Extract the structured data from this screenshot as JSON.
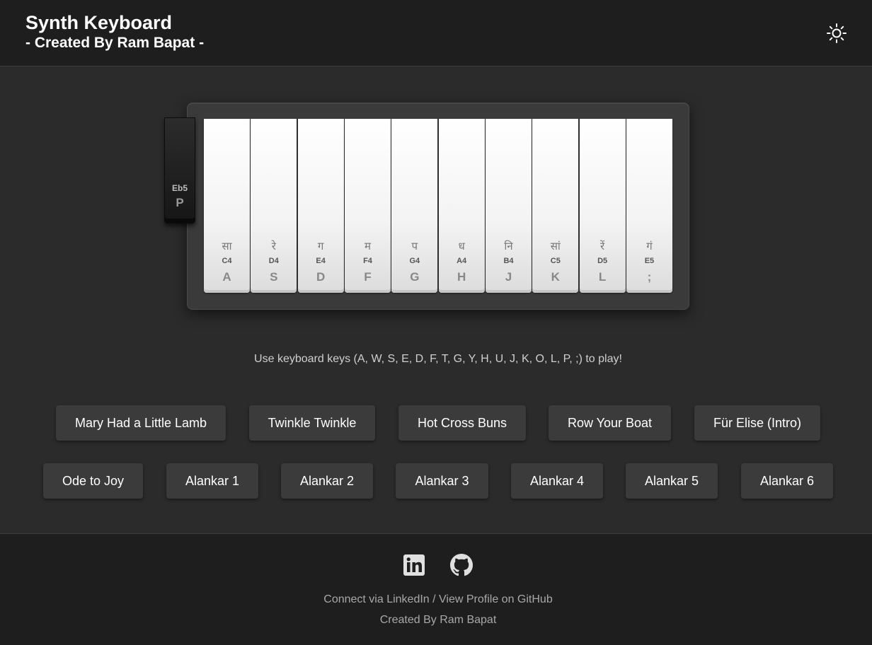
{
  "header": {
    "title": "Synth Keyboard",
    "subtitle": "- Created By Ram Bapat -",
    "theme_icon": "sun-icon"
  },
  "keyboard": {
    "white_keys": [
      {
        "sargam": "सा",
        "note": "C4",
        "key": "A"
      },
      {
        "sargam": "रे",
        "note": "D4",
        "key": "S"
      },
      {
        "sargam": "ग",
        "note": "E4",
        "key": "D"
      },
      {
        "sargam": "म",
        "note": "F4",
        "key": "F"
      },
      {
        "sargam": "प",
        "note": "G4",
        "key": "G"
      },
      {
        "sargam": "ध",
        "note": "A4",
        "key": "H"
      },
      {
        "sargam": "नि",
        "note": "B4",
        "key": "J"
      },
      {
        "sargam": "सां",
        "note": "C5",
        "key": "K"
      },
      {
        "sargam": "रें",
        "note": "D5",
        "key": "L"
      },
      {
        "sargam": "गं",
        "note": "E5",
        "key": ";"
      }
    ],
    "black_key": {
      "note": "Eb5",
      "key": "P"
    }
  },
  "instructions": "Use keyboard keys (A, W, S, E, D, F, T, G, Y, H, U, J, K, O, L, P, ;) to play!",
  "songs_row1": [
    "Mary Had a Little Lamb",
    "Twinkle Twinkle",
    "Hot Cross Buns",
    "Row Your Boat",
    "Für Elise (Intro)"
  ],
  "songs_row2": [
    "Ode to Joy",
    "Alankar 1",
    "Alankar 2",
    "Alankar 3",
    "Alankar 4",
    "Alankar 5",
    "Alankar 6"
  ],
  "footer": {
    "icons": [
      "linkedin-icon",
      "github-icon"
    ],
    "linkedin_link": "Connect via LinkedIn",
    "separator": " / ",
    "github_link": "View Profile on GitHub",
    "credit": "Created By Ram Bapat"
  },
  "colors": {
    "background": "#2b2b2b",
    "header_footer": "#1e1e1e",
    "button": "#3b3b3b"
  }
}
